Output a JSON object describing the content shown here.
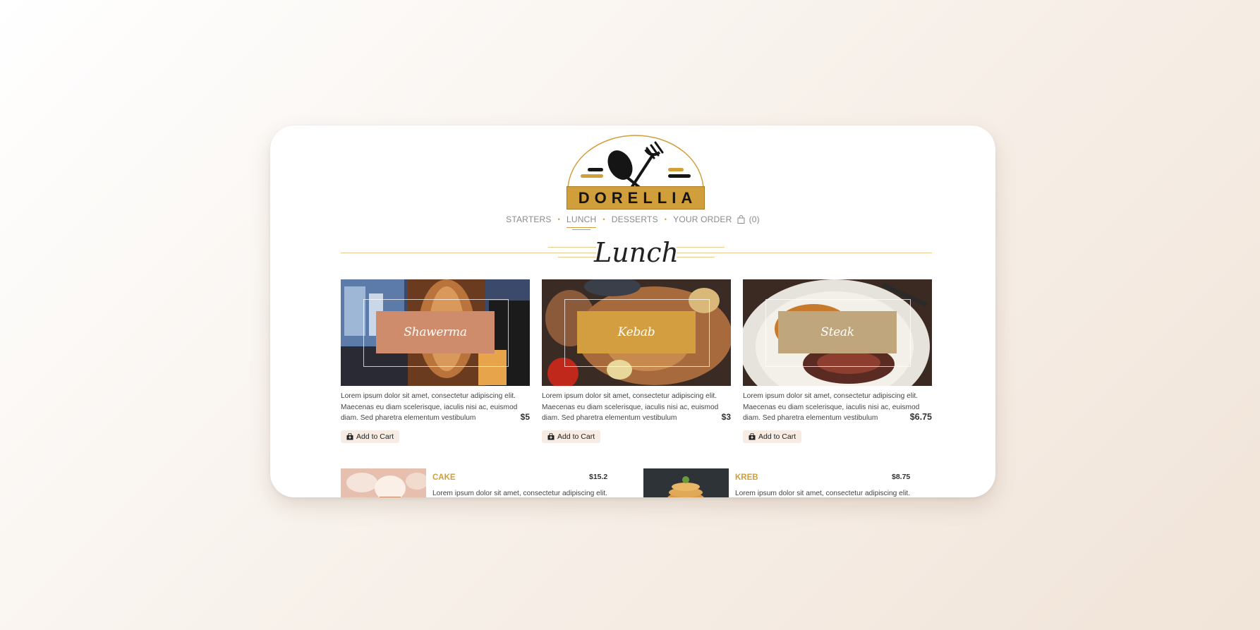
{
  "brand": {
    "name": "DORELLIA",
    "accent": "#d19e3c"
  },
  "nav": {
    "items": [
      {
        "label": "STARTERS",
        "active": false
      },
      {
        "label": "LUNCH",
        "active": true
      },
      {
        "label": "DESSERTS",
        "active": false
      }
    ],
    "order_label": "YOUR ORDER",
    "order_count": "(0)"
  },
  "section": {
    "title": "Lunch"
  },
  "features": [
    {
      "name": "Shawerma",
      "label_color": "#cf8c6c",
      "desc": "Lorem ipsum dolor sit amet, consectetur adipiscing elit. Maecenas eu diam scelerisque, iaculis nisi ac, euismod diam. Sed pharetra elementum vestibulum",
      "price": "$5",
      "cart_label": "Add to Cart"
    },
    {
      "name": "Kebab",
      "label_color": "#d39e3f",
      "desc": "Lorem ipsum dolor sit amet, consectetur adipiscing elit. Maecenas eu diam scelerisque, iaculis nisi ac, euismod diam. Sed pharetra elementum vestibulum",
      "price": "$3",
      "cart_label": "Add to Cart"
    },
    {
      "name": "Steak",
      "label_color": "#c0a67c",
      "desc": "Lorem ipsum dolor sit amet, consectetur adipiscing elit. Maecenas eu diam scelerisque, iaculis nisi ac, euismod diam. Sed pharetra elementum vestibulum",
      "price": "$6.75",
      "cart_label": "Add to Cart"
    }
  ],
  "list_items": [
    {
      "name": "CAKE",
      "price": "$15.2",
      "desc": "Lorem ipsum dolor sit amet, consectetur adipiscing elit."
    },
    {
      "name": "KREB",
      "price": "$8.75",
      "desc": "Lorem ipsum dolor sit amet, consectetur adipiscing elit."
    }
  ]
}
